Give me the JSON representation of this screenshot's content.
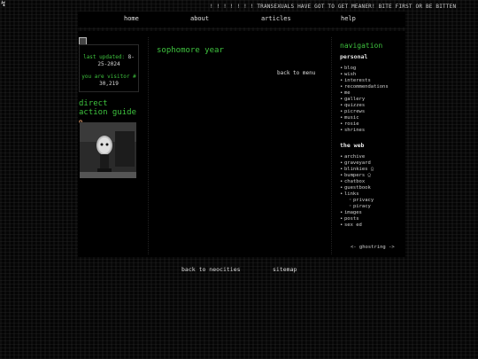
{
  "header": {
    "marquee": "! ! ! ! ! ! ! TRANSEXUALS HAVE GOT TO GET MEANER! BITE FIRST OR BE BITTEN"
  },
  "topnav": [
    "home",
    "about",
    "articles",
    "help"
  ],
  "left": {
    "updated_label": "last updated:",
    "updated_value": "8-25-2024",
    "visitor_label": "you are visitor #",
    "visitor_value": "30,219",
    "dag_title": "direct action guide"
  },
  "content": {
    "title": "sophomore year",
    "back": "back to menu"
  },
  "nav": {
    "title": "navigation",
    "personal": "personal",
    "personal_items": [
      "blog",
      "wish",
      "interests",
      "recommendations",
      "me",
      "gallery",
      "quizzes",
      "picrews",
      "music",
      "rosie",
      "shrines"
    ],
    "web": "the web",
    "web_items": [
      "archive",
      "graveyard",
      "blinkies",
      "bumpers",
      "chatbox",
      "guestbook",
      "links"
    ],
    "links_sub": [
      "privacy",
      "piracy"
    ],
    "web_items2": [
      "images",
      "posts",
      "sex ed"
    ],
    "ghost": "<- ghostring ->"
  },
  "footer": {
    "neocities": "back to neocities",
    "sitemap": "sitemap"
  },
  "colors": {
    "accent": "#3ec23e",
    "bg": "#000000"
  }
}
